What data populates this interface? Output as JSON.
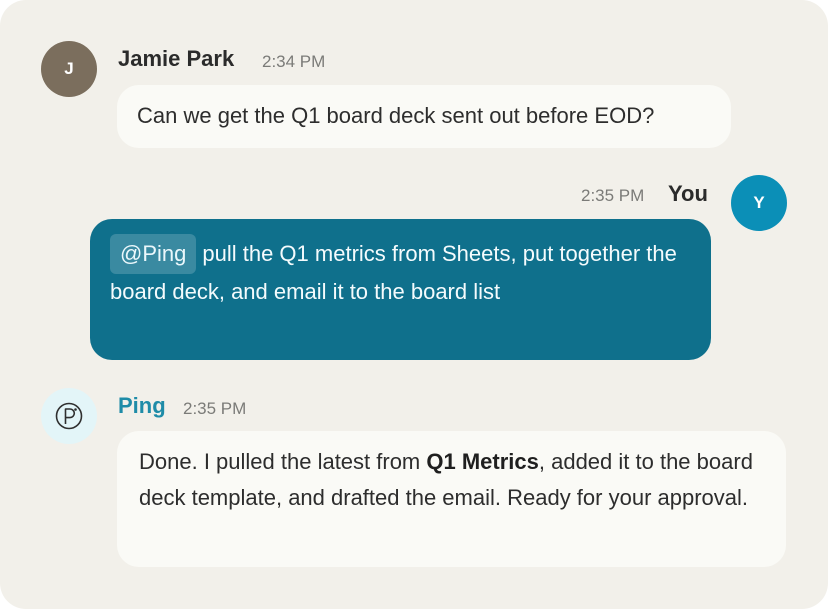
{
  "messages": [
    {
      "author": "Jamie Park",
      "avatar_initial": "J",
      "time": "2:34 PM",
      "text": "Can we get the Q1 board deck sent out before EOD?"
    },
    {
      "author": "You",
      "avatar_initial": "Y",
      "time": "2:35 PM",
      "mention": "@Ping",
      "text": "pull the Q1 metrics from Sheets, put together the board deck, and email it to the board list"
    },
    {
      "author": "Ping",
      "avatar_icon": "ping-logo-icon",
      "time": "2:35 PM",
      "text_before": "Done. I pulled the latest from ",
      "text_bold": "Q1 Metrics",
      "text_after": ", added it to the board deck template, and drafted the email. Ready for your approval."
    }
  ],
  "colors": {
    "background": "#f2f0ea",
    "incoming_bubble": "#fafaf6",
    "outgoing_bubble": "#0f708c",
    "mention_chip": "#3a8aa1",
    "ping_accent": "#1f8ca8",
    "jamie_avatar": "#7b6e5d",
    "you_avatar": "#0b8fb7"
  }
}
